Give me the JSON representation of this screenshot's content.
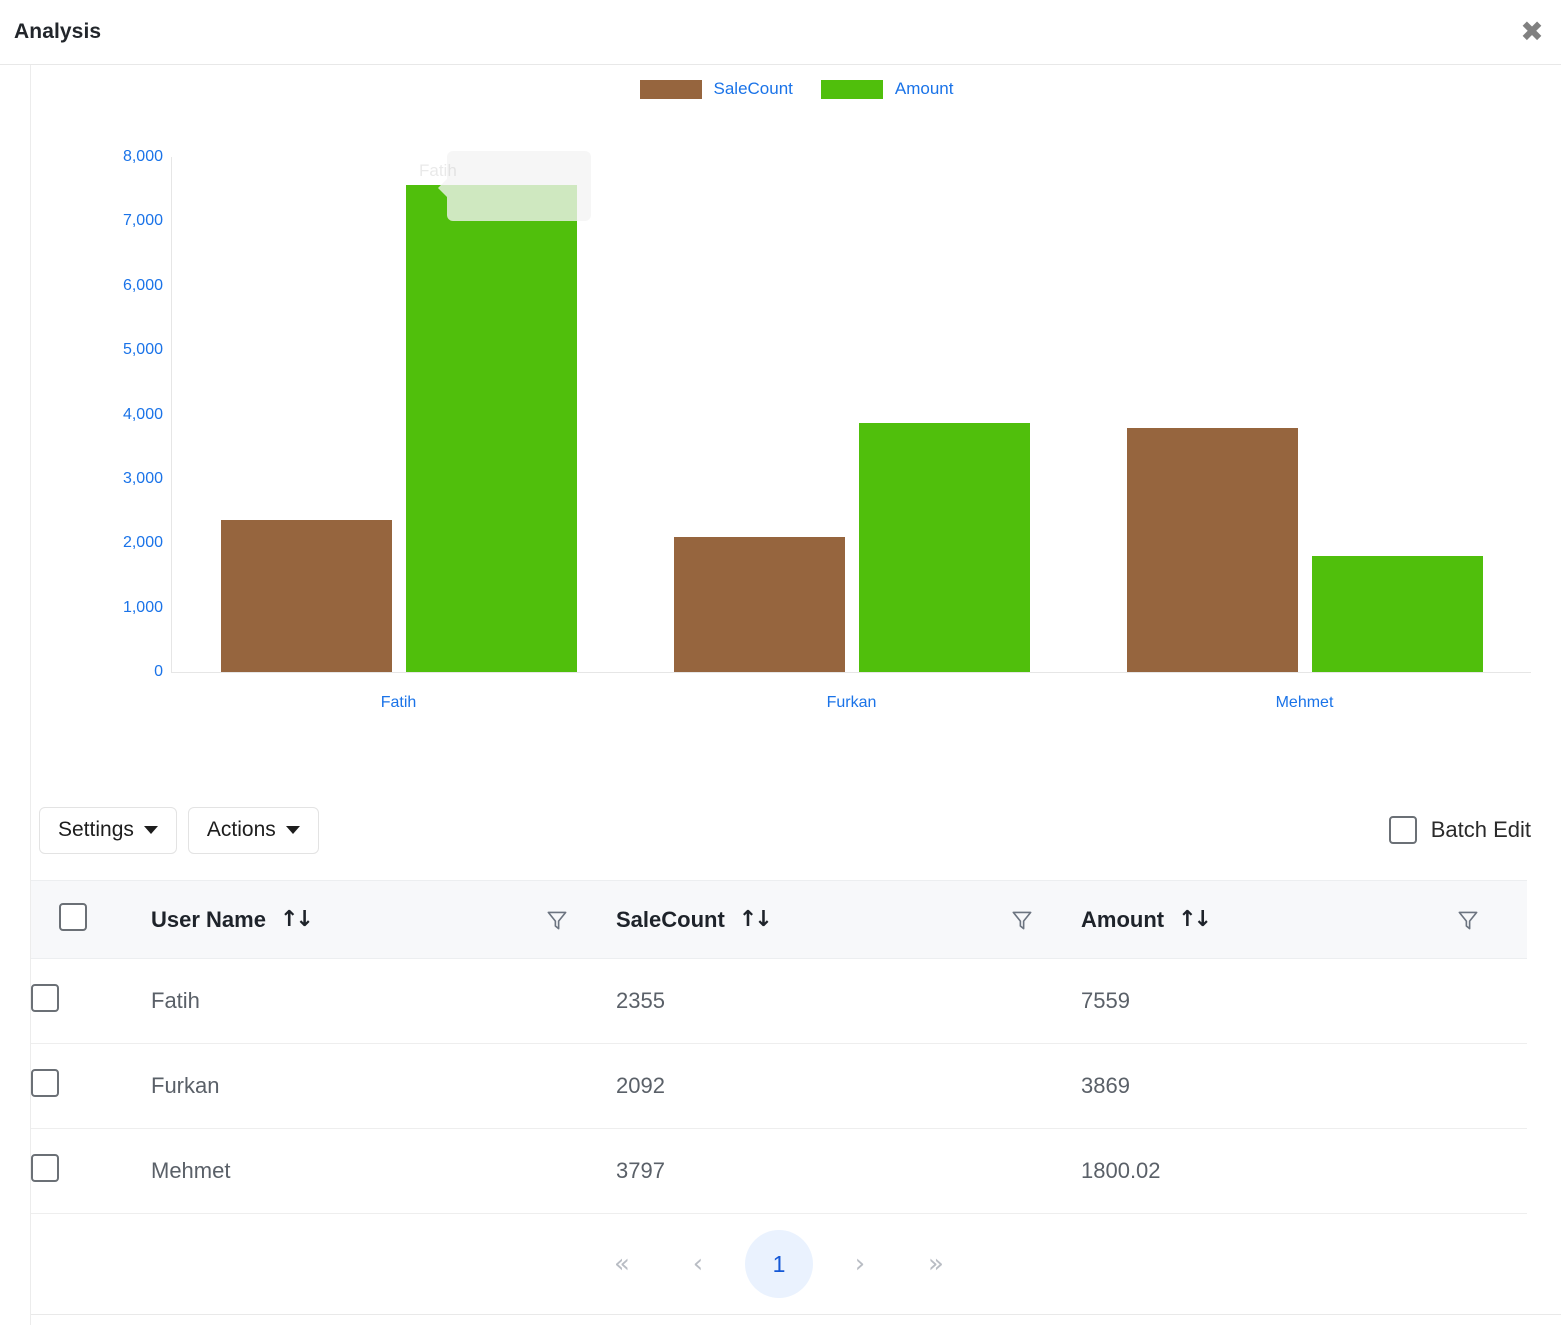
{
  "header": {
    "title": "Analysis",
    "close_icon": "close-icon",
    "close_glyph": "✖"
  },
  "chart_data": {
    "type": "bar",
    "title": "",
    "xlabel": "",
    "ylabel": "",
    "categories": [
      "Fatih",
      "Furkan",
      "Mehmet"
    ],
    "series": [
      {
        "name": "SaleCount",
        "color": "#96653e",
        "values": [
          2355,
          2092,
          3797
        ]
      },
      {
        "name": "Amount",
        "color": "#50bf0c",
        "values": [
          7559,
          3869,
          1800.02
        ]
      }
    ],
    "ylim": [
      0,
      8000
    ],
    "yticks": [
      8000,
      7000,
      6000,
      5000,
      4000,
      3000,
      2000,
      1000,
      0
    ],
    "ytick_labels": [
      "8,000",
      "7,000",
      "6,000",
      "5,000",
      "4,000",
      "3,000",
      "2,000",
      "1,000",
      "0"
    ],
    "grid": false,
    "legend_position": "top-center",
    "axis_label_color": "#1a73e8",
    "tooltip": {
      "visible": true,
      "fading": true,
      "text": "Fatih",
      "anchor_category": "Fatih",
      "anchor_series": "Amount"
    }
  },
  "toolbar": {
    "settings_label": "Settings",
    "actions_label": "Actions",
    "batch_edit_label": "Batch Edit",
    "batch_edit_checked": false
  },
  "table": {
    "select_all_checked": false,
    "columns": [
      {
        "key": "check",
        "label": ""
      },
      {
        "key": "name",
        "label": "User Name",
        "sortable": true,
        "filterable": true
      },
      {
        "key": "count",
        "label": "SaleCount",
        "sortable": true,
        "filterable": true
      },
      {
        "key": "amount",
        "label": "Amount",
        "sortable": true,
        "filterable": true
      }
    ],
    "sort_glyph": "↑↓",
    "rows": [
      {
        "checked": false,
        "name": "Fatih",
        "count": "2355",
        "amount": "7559"
      },
      {
        "checked": false,
        "name": "Furkan",
        "count": "2092",
        "amount": "3869"
      },
      {
        "checked": false,
        "name": "Mehmet",
        "count": "3797",
        "amount": "1800.02"
      }
    ]
  },
  "pagination": {
    "first_glyph": "«",
    "prev_glyph": "‹",
    "next_glyph": "›",
    "last_glyph": "»",
    "current_page": "1"
  },
  "colors": {
    "accent_blue": "#1a73e8",
    "series_brown": "#96653e",
    "series_green": "#50bf0c",
    "pager_active_bg": "#eaf2fe"
  }
}
